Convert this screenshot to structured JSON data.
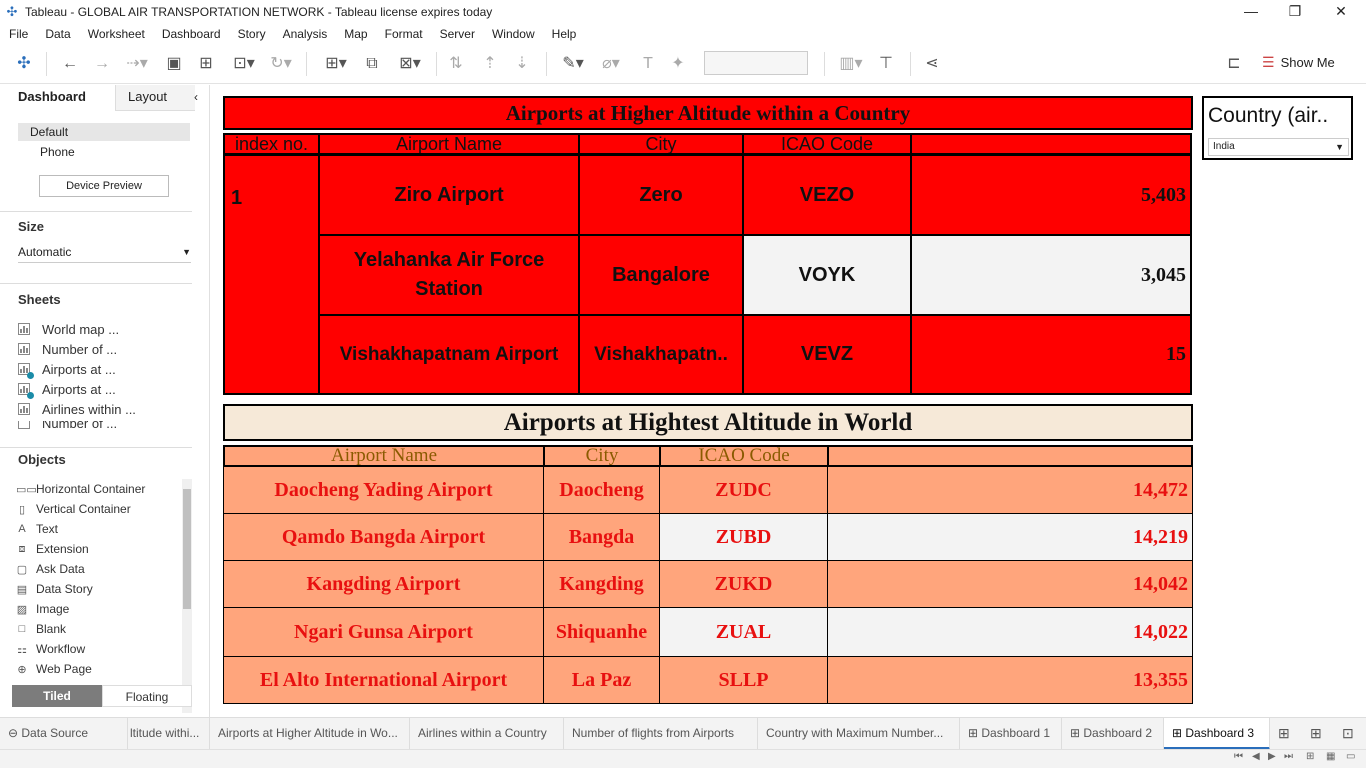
{
  "window": {
    "title": "Tableau - GLOBAL AIR TRANSPORTATION NETWORK - Tableau license expires today",
    "minimize": "—",
    "restore": "❐",
    "close": "✕"
  },
  "menu": [
    "File",
    "Data",
    "Worksheet",
    "Dashboard",
    "Story",
    "Analysis",
    "Map",
    "Format",
    "Server",
    "Window",
    "Help"
  ],
  "toolbar": {
    "show_me": "Show Me"
  },
  "left_panel": {
    "tabs": {
      "dashboard": "Dashboard",
      "layout": "Layout"
    },
    "devices": {
      "default": "Default",
      "phone": "Phone",
      "preview_button": "Device Preview"
    },
    "size": {
      "header": "Size",
      "value": "Automatic"
    },
    "sheets": {
      "header": "Sheets",
      "items": [
        "World map ...",
        "Number of ...",
        "Airports at ...",
        "Airports at ...",
        "Airlines within ...",
        "Number of ..."
      ]
    },
    "objects": {
      "header": "Objects",
      "items": [
        "Horizontal Container",
        "Vertical Container",
        "Text",
        "Extension",
        "Ask Data",
        "Data Story",
        "Image",
        "Blank",
        "Workflow",
        "Web Page"
      ]
    },
    "layout_toggle": {
      "tiled": "Tiled",
      "floating": "Floating"
    }
  },
  "dashboard": {
    "country_table": {
      "title": "Airports at Higher Altitude within a Country",
      "headers": [
        "index no.",
        "Airport Name",
        "City",
        "ICAO Code",
        ""
      ],
      "index": "1",
      "rows": [
        {
          "airport": "Ziro Airport",
          "city": "Zero",
          "icao": "VEZO",
          "altitude": "5,403"
        },
        {
          "airport": "Yelahanka Air Force Station",
          "city": "Bangalore",
          "icao": "VOYK",
          "altitude": "3,045"
        },
        {
          "airport": "Vishakhapatnam Airport",
          "city": "Vishakhapatn..",
          "icao": "VEVZ",
          "altitude": "15"
        }
      ]
    },
    "world_table": {
      "title": "Airports at Hightest Altitude in World",
      "headers": [
        "Airport Name",
        "City",
        "ICAO Code",
        ""
      ],
      "rows": [
        {
          "airport": "Daocheng Yading Airport",
          "city": "Daocheng",
          "icao": "ZUDC",
          "altitude": "14,472"
        },
        {
          "airport": "Qamdo Bangda Airport",
          "city": "Bangda",
          "icao": "ZUBD",
          "altitude": "14,219"
        },
        {
          "airport": "Kangding Airport",
          "city": "Kangding",
          "icao": "ZUKD",
          "altitude": "14,042"
        },
        {
          "airport": "Ngari Gunsa Airport",
          "city": "Shiquanhe",
          "icao": "ZUAL",
          "altitude": "14,022"
        },
        {
          "airport": "El Alto International Airport",
          "city": "La Paz",
          "icao": "SLLP",
          "altitude": "13,355"
        }
      ]
    },
    "filter": {
      "title": "Country (air..",
      "value": "India"
    }
  },
  "bottom_tabs": {
    "data_source": "Data Source",
    "sheets": [
      "ltitude withi...",
      "Airports at Higher Altitude in Wo...",
      "Airlines within a Country",
      "Number of flights from Airports",
      "Country with Maximum Number..."
    ],
    "dashboards": [
      "Dashboard 1",
      "Dashboard 2",
      "Dashboard 3"
    ]
  },
  "colors": {
    "red_table": "#ff0000",
    "salmon_table": "#ffa57c",
    "highlight_text": "#e81010",
    "world_title_bg": "#f6e9d8"
  }
}
